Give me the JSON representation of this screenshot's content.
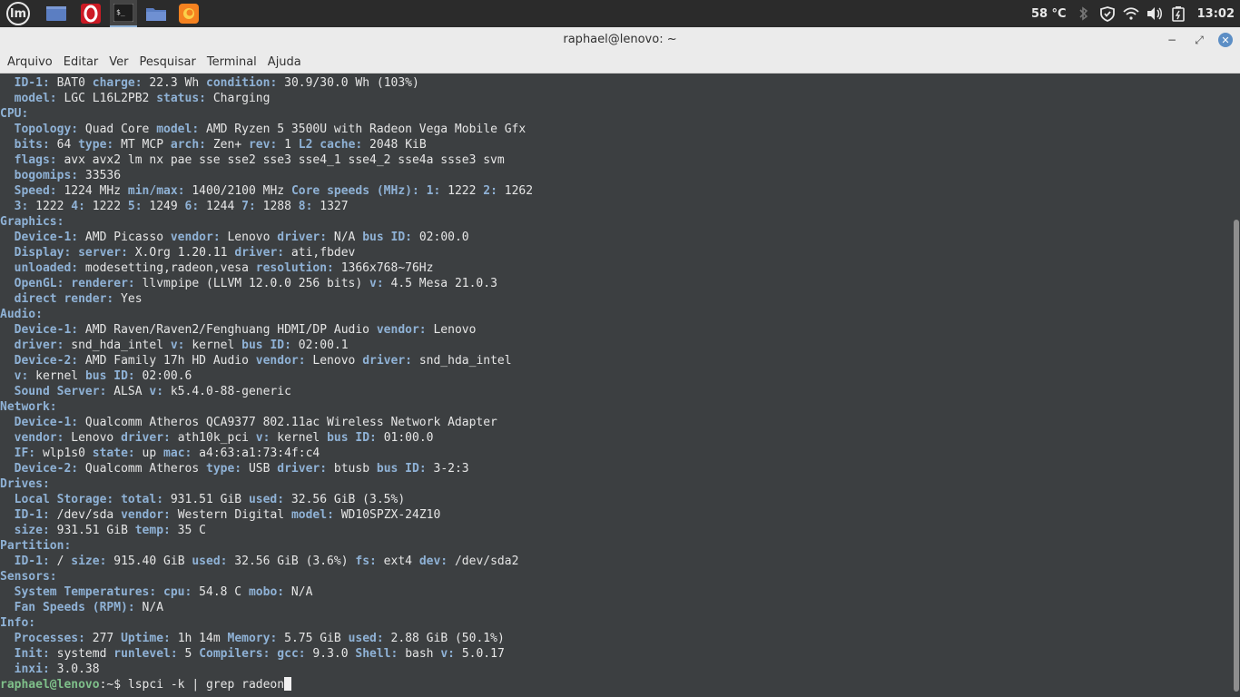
{
  "panel": {
    "temperature": "58 °C",
    "clock": "13:02",
    "launchers": [
      "menu-icon",
      "show-desktop-icon",
      "opera-icon",
      "terminal-icon",
      "files-icon",
      "firefox-icon"
    ]
  },
  "window": {
    "title": "raphael@lenovo: ~",
    "minimize": "−",
    "maximize": "⤢",
    "close": "✕"
  },
  "menu": [
    "Arquivo",
    "Editar",
    "Ver",
    "Pesquisar",
    "Terminal",
    "Ajuda"
  ],
  "terminal": {
    "lines": [
      [
        [
          "  ",
          "v"
        ],
        [
          "ID-1:",
          "k"
        ],
        [
          " BAT0 ",
          "v"
        ],
        [
          "charge:",
          "k"
        ],
        [
          " 22.3 Wh ",
          "v"
        ],
        [
          "condition:",
          "k"
        ],
        [
          " 30.9/30.0 Wh (103%)",
          "v"
        ]
      ],
      [
        [
          "  ",
          "v"
        ],
        [
          "model:",
          "k"
        ],
        [
          " LGC L16L2PB2 ",
          "v"
        ],
        [
          "status:",
          "k"
        ],
        [
          " Charging",
          "v"
        ]
      ],
      [
        [
          "CPU:",
          "k"
        ]
      ],
      [
        [
          "  ",
          "v"
        ],
        [
          "Topology:",
          "k"
        ],
        [
          " Quad Core ",
          "v"
        ],
        [
          "model:",
          "k"
        ],
        [
          " AMD Ryzen 5 3500U with Radeon Vega Mobile Gfx",
          "v"
        ]
      ],
      [
        [
          "  ",
          "v"
        ],
        [
          "bits:",
          "k"
        ],
        [
          " 64 ",
          "v"
        ],
        [
          "type:",
          "k"
        ],
        [
          " MT MCP ",
          "v"
        ],
        [
          "arch:",
          "k"
        ],
        [
          " Zen+ ",
          "v"
        ],
        [
          "rev:",
          "k"
        ],
        [
          " 1 ",
          "v"
        ],
        [
          "L2 cache:",
          "k"
        ],
        [
          " 2048 KiB",
          "v"
        ]
      ],
      [
        [
          "  ",
          "v"
        ],
        [
          "flags:",
          "k"
        ],
        [
          " avx avx2 lm nx pae sse sse2 sse3 sse4_1 sse4_2 sse4a ssse3 svm",
          "v"
        ]
      ],
      [
        [
          "  ",
          "v"
        ],
        [
          "bogomips:",
          "k"
        ],
        [
          " 33536",
          "v"
        ]
      ],
      [
        [
          "  ",
          "v"
        ],
        [
          "Speed:",
          "k"
        ],
        [
          " 1224 MHz ",
          "v"
        ],
        [
          "min/max:",
          "k"
        ],
        [
          " 1400/2100 MHz ",
          "v"
        ],
        [
          "Core speeds (MHz):",
          "k"
        ],
        [
          " ",
          "v"
        ],
        [
          "1:",
          "k"
        ],
        [
          " 1222 ",
          "v"
        ],
        [
          "2:",
          "k"
        ],
        [
          " 1262",
          "v"
        ]
      ],
      [
        [
          "  ",
          "v"
        ],
        [
          "3:",
          "k"
        ],
        [
          " 1222 ",
          "v"
        ],
        [
          "4:",
          "k"
        ],
        [
          " 1222 ",
          "v"
        ],
        [
          "5:",
          "k"
        ],
        [
          " 1249 ",
          "v"
        ],
        [
          "6:",
          "k"
        ],
        [
          " 1244 ",
          "v"
        ],
        [
          "7:",
          "k"
        ],
        [
          " 1288 ",
          "v"
        ],
        [
          "8:",
          "k"
        ],
        [
          " 1327",
          "v"
        ]
      ],
      [
        [
          "Graphics:",
          "k"
        ]
      ],
      [
        [
          "  ",
          "v"
        ],
        [
          "Device-1:",
          "k"
        ],
        [
          " AMD Picasso ",
          "v"
        ],
        [
          "vendor:",
          "k"
        ],
        [
          " Lenovo ",
          "v"
        ],
        [
          "driver:",
          "k"
        ],
        [
          " N/A ",
          "v"
        ],
        [
          "bus ID:",
          "k"
        ],
        [
          " 02:00.0",
          "v"
        ]
      ],
      [
        [
          "  ",
          "v"
        ],
        [
          "Display:",
          "k"
        ],
        [
          " ",
          "v"
        ],
        [
          "server:",
          "k"
        ],
        [
          " X.Org 1.20.11 ",
          "v"
        ],
        [
          "driver:",
          "k"
        ],
        [
          " ati,fbdev",
          "v"
        ]
      ],
      [
        [
          "  ",
          "v"
        ],
        [
          "unloaded:",
          "k"
        ],
        [
          " modesetting,radeon,vesa ",
          "v"
        ],
        [
          "resolution:",
          "k"
        ],
        [
          " 1366x768~76Hz",
          "v"
        ]
      ],
      [
        [
          "  ",
          "v"
        ],
        [
          "OpenGL:",
          "k"
        ],
        [
          " ",
          "v"
        ],
        [
          "renderer:",
          "k"
        ],
        [
          " llvmpipe (LLVM 12.0.0 256 bits) ",
          "v"
        ],
        [
          "v:",
          "k"
        ],
        [
          " 4.5 Mesa 21.0.3",
          "v"
        ]
      ],
      [
        [
          "  ",
          "v"
        ],
        [
          "direct render:",
          "k"
        ],
        [
          " Yes",
          "v"
        ]
      ],
      [
        [
          "Audio:",
          "k"
        ]
      ],
      [
        [
          "  ",
          "v"
        ],
        [
          "Device-1:",
          "k"
        ],
        [
          " AMD Raven/Raven2/Fenghuang HDMI/DP Audio ",
          "v"
        ],
        [
          "vendor:",
          "k"
        ],
        [
          " Lenovo",
          "v"
        ]
      ],
      [
        [
          "  ",
          "v"
        ],
        [
          "driver:",
          "k"
        ],
        [
          " snd_hda_intel ",
          "v"
        ],
        [
          "v:",
          "k"
        ],
        [
          " kernel ",
          "v"
        ],
        [
          "bus ID:",
          "k"
        ],
        [
          " 02:00.1",
          "v"
        ]
      ],
      [
        [
          "  ",
          "v"
        ],
        [
          "Device-2:",
          "k"
        ],
        [
          " AMD Family 17h HD Audio ",
          "v"
        ],
        [
          "vendor:",
          "k"
        ],
        [
          " Lenovo ",
          "v"
        ],
        [
          "driver:",
          "k"
        ],
        [
          " snd_hda_intel",
          "v"
        ]
      ],
      [
        [
          "  ",
          "v"
        ],
        [
          "v:",
          "k"
        ],
        [
          " kernel ",
          "v"
        ],
        [
          "bus ID:",
          "k"
        ],
        [
          " 02:00.6",
          "v"
        ]
      ],
      [
        [
          "  ",
          "v"
        ],
        [
          "Sound Server:",
          "k"
        ],
        [
          " ALSA ",
          "v"
        ],
        [
          "v:",
          "k"
        ],
        [
          " k5.4.0-88-generic",
          "v"
        ]
      ],
      [
        [
          "Network:",
          "k"
        ]
      ],
      [
        [
          "  ",
          "v"
        ],
        [
          "Device-1:",
          "k"
        ],
        [
          " Qualcomm Atheros QCA9377 802.11ac Wireless Network Adapter",
          "v"
        ]
      ],
      [
        [
          "  ",
          "v"
        ],
        [
          "vendor:",
          "k"
        ],
        [
          " Lenovo ",
          "v"
        ],
        [
          "driver:",
          "k"
        ],
        [
          " ath10k_pci ",
          "v"
        ],
        [
          "v:",
          "k"
        ],
        [
          " kernel ",
          "v"
        ],
        [
          "bus ID:",
          "k"
        ],
        [
          " 01:00.0",
          "v"
        ]
      ],
      [
        [
          "  ",
          "v"
        ],
        [
          "IF:",
          "k"
        ],
        [
          " wlp1s0 ",
          "v"
        ],
        [
          "state:",
          "k"
        ],
        [
          " up ",
          "v"
        ],
        [
          "mac:",
          "k"
        ],
        [
          " a4:63:a1:73:4f:c4",
          "v"
        ]
      ],
      [
        [
          "  ",
          "v"
        ],
        [
          "Device-2:",
          "k"
        ],
        [
          " Qualcomm Atheros ",
          "v"
        ],
        [
          "type:",
          "k"
        ],
        [
          " USB ",
          "v"
        ],
        [
          "driver:",
          "k"
        ],
        [
          " btusb ",
          "v"
        ],
        [
          "bus ID:",
          "k"
        ],
        [
          " 3-2:3",
          "v"
        ]
      ],
      [
        [
          "Drives:",
          "k"
        ]
      ],
      [
        [
          "  ",
          "v"
        ],
        [
          "Local Storage:",
          "k"
        ],
        [
          " ",
          "v"
        ],
        [
          "total:",
          "k"
        ],
        [
          " 931.51 GiB ",
          "v"
        ],
        [
          "used:",
          "k"
        ],
        [
          " 32.56 GiB (3.5%)",
          "v"
        ]
      ],
      [
        [
          "  ",
          "v"
        ],
        [
          "ID-1:",
          "k"
        ],
        [
          " /dev/sda ",
          "v"
        ],
        [
          "vendor:",
          "k"
        ],
        [
          " Western Digital ",
          "v"
        ],
        [
          "model:",
          "k"
        ],
        [
          " WD10SPZX-24Z10",
          "v"
        ]
      ],
      [
        [
          "  ",
          "v"
        ],
        [
          "size:",
          "k"
        ],
        [
          " 931.51 GiB ",
          "v"
        ],
        [
          "temp:",
          "k"
        ],
        [
          " 35 C",
          "v"
        ]
      ],
      [
        [
          "Partition:",
          "k"
        ]
      ],
      [
        [
          "  ",
          "v"
        ],
        [
          "ID-1:",
          "k"
        ],
        [
          " / ",
          "v"
        ],
        [
          "size:",
          "k"
        ],
        [
          " 915.40 GiB ",
          "v"
        ],
        [
          "used:",
          "k"
        ],
        [
          " 32.56 GiB (3.6%) ",
          "v"
        ],
        [
          "fs:",
          "k"
        ],
        [
          " ext4 ",
          "v"
        ],
        [
          "dev:",
          "k"
        ],
        [
          " /dev/sda2",
          "v"
        ]
      ],
      [
        [
          "Sensors:",
          "k"
        ]
      ],
      [
        [
          "  ",
          "v"
        ],
        [
          "System Temperatures:",
          "k"
        ],
        [
          " ",
          "v"
        ],
        [
          "cpu:",
          "k"
        ],
        [
          " 54.8 C ",
          "v"
        ],
        [
          "mobo:",
          "k"
        ],
        [
          " N/A",
          "v"
        ]
      ],
      [
        [
          "  ",
          "v"
        ],
        [
          "Fan Speeds (RPM):",
          "k"
        ],
        [
          " N/A",
          "v"
        ]
      ],
      [
        [
          "Info:",
          "k"
        ]
      ],
      [
        [
          "  ",
          "v"
        ],
        [
          "Processes:",
          "k"
        ],
        [
          " 277 ",
          "v"
        ],
        [
          "Uptime:",
          "k"
        ],
        [
          " 1h 14m ",
          "v"
        ],
        [
          "Memory:",
          "k"
        ],
        [
          " 5.75 GiB ",
          "v"
        ],
        [
          "used:",
          "k"
        ],
        [
          " 2.88 GiB (50.1%)",
          "v"
        ]
      ],
      [
        [
          "  ",
          "v"
        ],
        [
          "Init:",
          "k"
        ],
        [
          " systemd ",
          "v"
        ],
        [
          "runlevel:",
          "k"
        ],
        [
          " 5 ",
          "v"
        ],
        [
          "Compilers:",
          "k"
        ],
        [
          " ",
          "v"
        ],
        [
          "gcc:",
          "k"
        ],
        [
          " 9.3.0 ",
          "v"
        ],
        [
          "Shell:",
          "k"
        ],
        [
          " bash ",
          "v"
        ],
        [
          "v:",
          "k"
        ],
        [
          " 5.0.17",
          "v"
        ]
      ],
      [
        [
          "  ",
          "v"
        ],
        [
          "inxi:",
          "k"
        ],
        [
          " 3.0.38",
          "v"
        ]
      ]
    ],
    "prompt_user": "raphael@lenovo",
    "prompt_path": ":~$ ",
    "command": "lspci -k | grep radeon"
  }
}
